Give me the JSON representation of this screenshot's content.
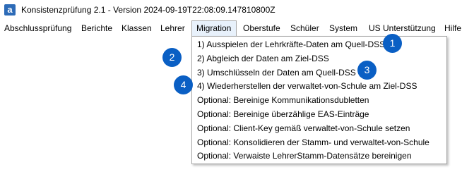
{
  "window": {
    "icon_letter": "a",
    "title": "Konsistenzprüfung 2.1 - Version 2024-09-19T22:08:09.147810800Z"
  },
  "menubar": {
    "items": [
      {
        "label": "Abschlussprüfung"
      },
      {
        "label": "Berichte"
      },
      {
        "label": "Klassen"
      },
      {
        "label": "Lehrer"
      },
      {
        "label": "Migration"
      },
      {
        "label": "Oberstufe"
      },
      {
        "label": "Schüler"
      },
      {
        "label": "System"
      },
      {
        "label": "US Unterstützung"
      },
      {
        "label": "Hilfe"
      }
    ],
    "active": "Migration"
  },
  "dropdown": {
    "items": [
      {
        "label": "1) Ausspielen der Lehrkräfte-Daten am Quell-DSS"
      },
      {
        "label": "2) Abgleich der Daten am Ziel-DSS"
      },
      {
        "label": "3) Umschlüsseln der Daten am Quell-DSS"
      },
      {
        "label": "4) Wiederherstellen der verwaltet-von-Schule am Ziel-DSS"
      },
      {
        "label": "Optional: Bereinige Kommunikationsdubletten"
      },
      {
        "label": "Optional: Bereinige überzählige EAS-Einträge"
      },
      {
        "label": "Optional: Client-Key gemäß verwaltet-von-Schule setzen"
      },
      {
        "label": "Optional: Konsolidieren der Stamm- und verwaltet-von-Schule"
      },
      {
        "label": "Optional: Verwaiste LehrerStamm-Datensätze bereinigen"
      }
    ]
  },
  "badges": [
    {
      "number": "1"
    },
    {
      "number": "2"
    },
    {
      "number": "3"
    },
    {
      "number": "4"
    }
  ],
  "colors": {
    "badge": "#0a5fc4",
    "active_menu_bg": "#e8f1fb",
    "border": "#a7a7a7"
  }
}
